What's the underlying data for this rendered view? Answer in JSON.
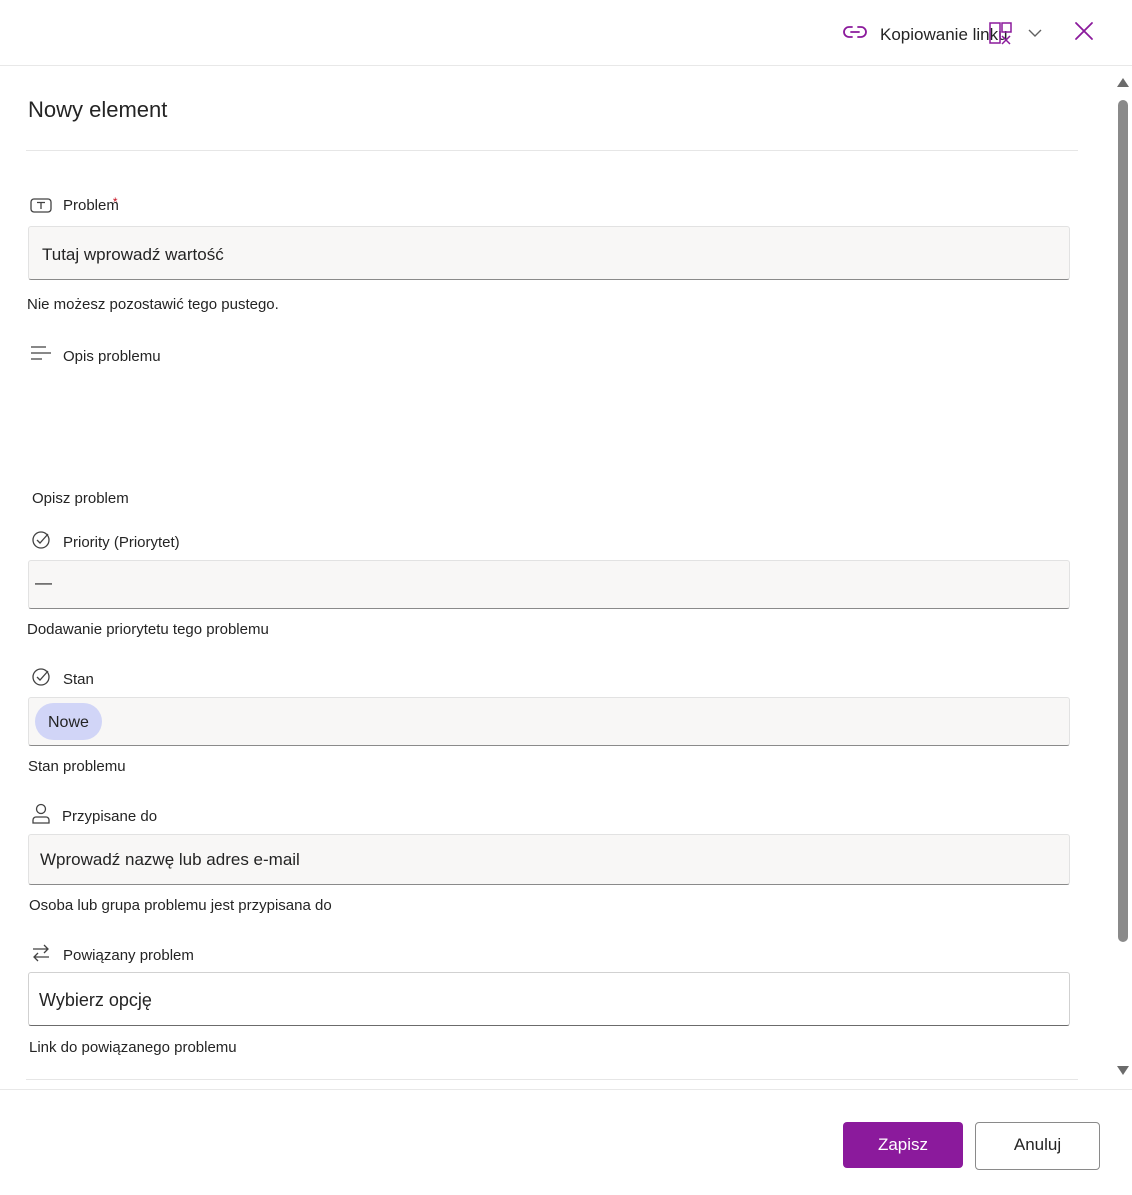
{
  "header": {
    "copy_link_label": "Kopiowanie linku",
    "icons": [
      "link-icon",
      "panel-icon",
      "chevron-down-icon",
      "close-icon"
    ]
  },
  "form": {
    "title": "Nowy element",
    "fields": {
      "problem": {
        "label": "Problem",
        "required_marker": "*",
        "placeholder": "Tutaj wprowadź wartość",
        "help": "Nie możesz pozostawić tego pustego.",
        "icon": "text-field-icon"
      },
      "description": {
        "label": "Opis problemu",
        "help": "Opisz problem",
        "icon": "multiline-text-icon"
      },
      "priority": {
        "label": "Priority (Priorytet)",
        "value": "—",
        "help": "Dodawanie priorytetu tego problemu",
        "icon": "choice-check-icon"
      },
      "status": {
        "label": "Stan",
        "value": "Nowe",
        "help": "Stan problemu",
        "icon": "choice-check-icon"
      },
      "assigned_to": {
        "label": "Przypisane do",
        "placeholder": "Wprowadź nazwę lub adres e-mail",
        "help": "Osoba lub grupa problemu jest przypisana do",
        "icon": "person-icon"
      },
      "related_issue": {
        "label": "Powiązany problem",
        "placeholder": "Wybierz opcję",
        "help": "Link do powiązanego problemu",
        "icon": "lookup-arrows-icon"
      }
    }
  },
  "footer": {
    "save_label": "Zapisz",
    "cancel_label": "Anuluj"
  },
  "colors": {
    "accent": "#8b1a9c",
    "pill": "#d1d5f7",
    "field_bg": "#f8f7f6"
  }
}
